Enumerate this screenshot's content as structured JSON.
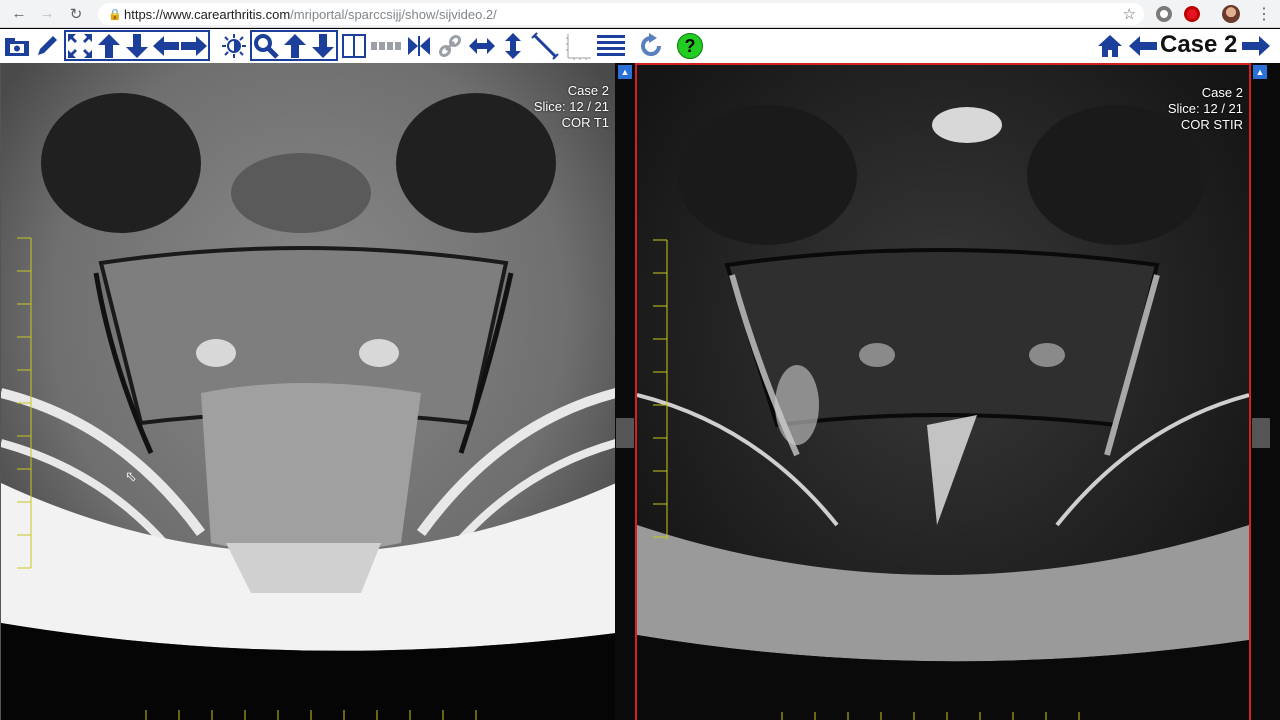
{
  "browser": {
    "url_host": "https://www.carearthritis.com",
    "url_path": "/mriportal/sparccsijj/show/sijvideo.2/"
  },
  "toolbar": {
    "case_label": "Case 2",
    "help_symbol": "?"
  },
  "viewports": [
    {
      "case": "Case 2",
      "slice": "Slice: 12 / 21",
      "sequence": "COR T1"
    },
    {
      "case": "Case 2",
      "slice": "Slice: 12 / 21",
      "sequence": "COR STIR"
    }
  ],
  "colors": {
    "toolbar_icon": "#1b3f9a",
    "active_viewport_border": "#d42020",
    "help_button": "#22cc22",
    "ruler": "#c8c820"
  }
}
